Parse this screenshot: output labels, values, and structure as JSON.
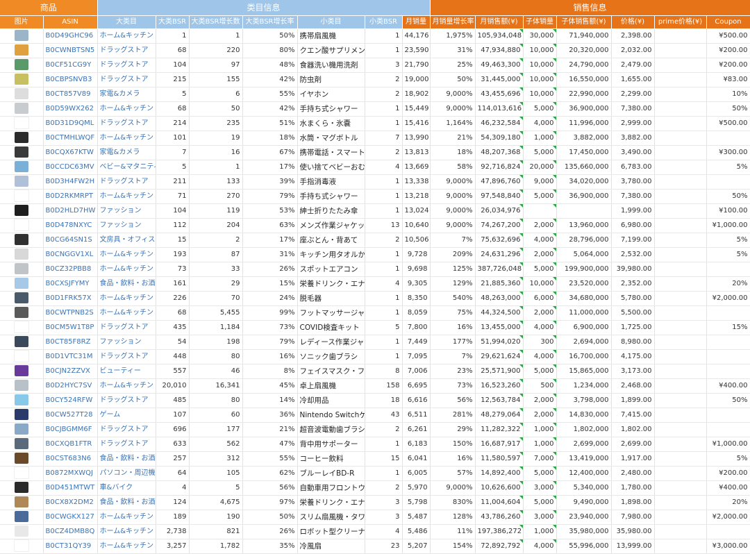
{
  "groups": [
    {
      "label": "商品",
      "span": 2,
      "cls": "h-prod"
    },
    {
      "label": "类目信息",
      "span": 7,
      "cls": "h-cat"
    },
    {
      "label": "销售信息",
      "span": 9,
      "cls": "h-sale"
    }
  ],
  "columns": [
    {
      "label": "图片",
      "cls": "h-prod"
    },
    {
      "label": "ASIN",
      "cls": "h-prod"
    },
    {
      "label": "大类目",
      "cls": "h-cat"
    },
    {
      "label": "大类BSR",
      "cls": "h-cat"
    },
    {
      "label": "大类BSR增长数",
      "cls": "h-cat"
    },
    {
      "label": "大类BSR增长率",
      "cls": "h-cat"
    },
    {
      "label": "小类目",
      "cls": "h-cat"
    },
    {
      "label": "小类BSR",
      "cls": "h-cat"
    },
    {
      "label": "月销量",
      "cls": "h-sale"
    },
    {
      "label": "月销量增长率",
      "cls": "h-sale"
    },
    {
      "label": "月销售额(¥)",
      "cls": "h-sale"
    },
    {
      "label": "子体销量",
      "cls": "h-sale"
    },
    {
      "label": "子体销售额(¥)",
      "cls": "h-sale"
    },
    {
      "label": "价格(¥)",
      "cls": "h-sale"
    },
    {
      "label": "prime价格(¥)",
      "cls": "h-sale"
    },
    {
      "label": "Coupon",
      "cls": "h-sale"
    }
  ],
  "rows": [
    {
      "thumb": "#9ab4c8",
      "asin": "B0D49GHC96",
      "cat": "ホーム&キッチン",
      "bsr": "1",
      "bsr_inc": "1",
      "bsr_rate": "50%",
      "sub": "携帯扇風機",
      "sub_bsr": "1",
      "sales": "44,176",
      "sales_rate": "1,975%",
      "revenue": "105,934,048",
      "child_sales": "30,000",
      "child_rev": "71,940,000",
      "price": "2,398.00",
      "prime": "",
      "coupon": "¥500.00"
    },
    {
      "thumb": "#e0a040",
      "asin": "B0CWNBTSN5",
      "cat": "ドラッグストア",
      "bsr": "68",
      "bsr_inc": "220",
      "bsr_rate": "80%",
      "sub": "クエン酸サプリメント",
      "sub_bsr": "1",
      "sales": "23,590",
      "sales_rate": "31%",
      "revenue": "47,934,880",
      "child_sales": "10,000",
      "child_rev": "20,320,000",
      "price": "2,032.00",
      "prime": "",
      "coupon": "¥200.00"
    },
    {
      "thumb": "#5a9a6a",
      "asin": "B0CF51CG9Y",
      "cat": "ドラッグストア",
      "bsr": "104",
      "bsr_inc": "97",
      "bsr_rate": "48%",
      "sub": "食器洗い機用洗剤",
      "sub_bsr": "3",
      "sales": "21,790",
      "sales_rate": "25%",
      "revenue": "49,463,300",
      "child_sales": "10,000",
      "child_rev": "24,790,000",
      "price": "2,479.00",
      "prime": "",
      "coupon": "¥200.00"
    },
    {
      "thumb": "#c8c060",
      "asin": "B0CBPSNVB3",
      "cat": "ドラッグストア",
      "bsr": "215",
      "bsr_inc": "155",
      "bsr_rate": "42%",
      "sub": "防虫剤",
      "sub_bsr": "2",
      "sales": "19,000",
      "sales_rate": "50%",
      "revenue": "31,445,000",
      "child_sales": "10,000",
      "child_rev": "16,550,000",
      "price": "1,655.00",
      "prime": "",
      "coupon": "¥83.00"
    },
    {
      "thumb": "#dddddd",
      "asin": "B0CT857V89",
      "cat": "家電&カメラ",
      "bsr": "5",
      "bsr_inc": "6",
      "bsr_rate": "55%",
      "sub": "イヤホン",
      "sub_bsr": "2",
      "sales": "18,902",
      "sales_rate": "9,000%",
      "revenue": "43,455,696",
      "child_sales": "10,000",
      "child_rev": "22,990,000",
      "price": "2,299.00",
      "prime": "",
      "coupon": "10%"
    },
    {
      "thumb": "#c8ccd0",
      "asin": "B0D59WX262",
      "cat": "ホーム&キッチン",
      "bsr": "68",
      "bsr_inc": "50",
      "bsr_rate": "42%",
      "sub": "手持ち式シャワー",
      "sub_bsr": "1",
      "sales": "15,449",
      "sales_rate": "9,000%",
      "revenue": "114,013,616",
      "child_sales": "5,000",
      "child_rev": "36,900,000",
      "price": "7,380.00",
      "prime": "",
      "coupon": "50%"
    },
    {
      "thumb": "#ffffff",
      "asin": "B0D31D9QML",
      "cat": "ドラッグストア",
      "bsr": "214",
      "bsr_inc": "235",
      "bsr_rate": "51%",
      "sub": "水まくら・氷嚢",
      "sub_bsr": "1",
      "sales": "15,416",
      "sales_rate": "1,164%",
      "revenue": "46,232,584",
      "child_sales": "4,000",
      "child_rev": "11,996,000",
      "price": "2,999.00",
      "prime": "",
      "coupon": "¥500.00"
    },
    {
      "thumb": "#2a2a2a",
      "asin": "B0CTMHLWQF",
      "cat": "ホーム&キッチン",
      "bsr": "101",
      "bsr_inc": "19",
      "bsr_rate": "18%",
      "sub": "水筒・マグボトル",
      "sub_bsr": "7",
      "sales": "13,990",
      "sales_rate": "21%",
      "revenue": "54,309,180",
      "child_sales": "1,000",
      "child_rev": "3,882,000",
      "price": "3,882.00",
      "prime": "",
      "coupon": ""
    },
    {
      "thumb": "#3a3a3a",
      "asin": "B0CQX67KTW",
      "cat": "家電&カメラ",
      "bsr": "7",
      "bsr_inc": "16",
      "bsr_rate": "67%",
      "sub": "携帯電話・スマートフォン用モバイルバッテリー",
      "sub_bsr": "2",
      "sales": "13,813",
      "sales_rate": "18%",
      "revenue": "48,207,368",
      "child_sales": "5,000",
      "child_rev": "17,450,000",
      "price": "3,490.00",
      "prime": "",
      "coupon": "¥300.00"
    },
    {
      "thumb": "#7ab0d8",
      "asin": "B0CCDC63MV",
      "cat": "ベビー&マタニティ",
      "bsr": "5",
      "bsr_inc": "1",
      "bsr_rate": "17%",
      "sub": "使い捨てベビーおむつ",
      "sub_bsr": "4",
      "sales": "13,669",
      "sales_rate": "58%",
      "revenue": "92,716,824",
      "child_sales": "20,000",
      "child_rev": "135,660,000",
      "price": "6,783.00",
      "prime": "",
      "coupon": "5%"
    },
    {
      "thumb": "#b0c0d8",
      "asin": "B0D3H4FW2H",
      "cat": "ドラッグストア",
      "bsr": "211",
      "bsr_inc": "133",
      "bsr_rate": "39%",
      "sub": "手指消毒液",
      "sub_bsr": "1",
      "sales": "13,338",
      "sales_rate": "9,000%",
      "revenue": "47,896,760",
      "child_sales": "9,000",
      "child_rev": "34,020,000",
      "price": "3,780.00",
      "prime": "",
      "coupon": ""
    },
    {
      "thumb": "#ffffff",
      "asin": "B0D2RKMRPT",
      "cat": "ホーム&キッチン",
      "bsr": "71",
      "bsr_inc": "270",
      "bsr_rate": "79%",
      "sub": "手持ち式シャワー",
      "sub_bsr": "1",
      "sales": "13,218",
      "sales_rate": "9,000%",
      "revenue": "97,548,840",
      "child_sales": "5,000",
      "child_rev": "36,900,000",
      "price": "7,380.00",
      "prime": "",
      "coupon": "50%"
    },
    {
      "thumb": "#1e1e1e",
      "asin": "B0D2HLD7HW",
      "cat": "ファッション",
      "bsr": "104",
      "bsr_inc": "119",
      "bsr_rate": "53%",
      "sub": "紳士折りたたみ傘",
      "sub_bsr": "1",
      "sales": "13,024",
      "sales_rate": "9,000%",
      "revenue": "26,034,976",
      "child_sales": "",
      "child_rev": "",
      "price": "1,999.00",
      "prime": "",
      "coupon": "¥100.00"
    },
    {
      "thumb": "#ffffff",
      "asin": "B0D478NXYC",
      "cat": "ファッション",
      "bsr": "112",
      "bsr_inc": "204",
      "bsr_rate": "63%",
      "sub": "メンズ作業ジャケット・コート",
      "sub_bsr": "13",
      "sales": "10,640",
      "sales_rate": "9,000%",
      "revenue": "74,267,200",
      "child_sales": "2,000",
      "child_rev": "13,960,000",
      "price": "6,980.00",
      "prime": "",
      "coupon": "¥1,000.00"
    },
    {
      "thumb": "#303030",
      "asin": "B0CG64SN1S",
      "cat": "文房具・オフィス",
      "bsr": "15",
      "bsr_inc": "2",
      "bsr_rate": "17%",
      "sub": "座ぶとん・背あて",
      "sub_bsr": "2",
      "sales": "10,506",
      "sales_rate": "7%",
      "revenue": "75,632,696",
      "child_sales": "4,000",
      "child_rev": "28,796,000",
      "price": "7,199.00",
      "prime": "",
      "coupon": "5%"
    },
    {
      "thumb": "#d8d8d8",
      "asin": "B0CNGGV1XL",
      "cat": "ホーム&キッチン",
      "bsr": "193",
      "bsr_inc": "87",
      "bsr_rate": "31%",
      "sub": "キッチン用タオルかけ・フック",
      "sub_bsr": "1",
      "sales": "9,728",
      "sales_rate": "209%",
      "revenue": "24,631,296",
      "child_sales": "2,000",
      "child_rev": "5,064,000",
      "price": "2,532.00",
      "prime": "",
      "coupon": "5%"
    },
    {
      "thumb": "#c0c4c8",
      "asin": "B0CZ32PBB8",
      "cat": "ホーム&キッチン",
      "bsr": "73",
      "bsr_inc": "33",
      "bsr_rate": "26%",
      "sub": "スポットエアコン",
      "sub_bsr": "1",
      "sales": "9,698",
      "sales_rate": "125%",
      "revenue": "387,726,048",
      "child_sales": "5,000",
      "child_rev": "199,900,000",
      "price": "39,980.00",
      "prime": "",
      "coupon": ""
    },
    {
      "thumb": "#a8c8e8",
      "asin": "B0CXSJFYMY",
      "cat": "食品・飲料・お酒",
      "bsr": "161",
      "bsr_inc": "29",
      "bsr_rate": "15%",
      "sub": "栄養ドリンク・エナジードリンク",
      "sub_bsr": "4",
      "sales": "9,305",
      "sales_rate": "129%",
      "revenue": "21,885,360",
      "child_sales": "10,000",
      "child_rev": "23,520,000",
      "price": "2,352.00",
      "prime": "",
      "coupon": "20%"
    },
    {
      "thumb": "#4a5a6a",
      "asin": "B0D1FRK57X",
      "cat": "ホーム&キッチン",
      "bsr": "226",
      "bsr_inc": "70",
      "bsr_rate": "24%",
      "sub": "脱毛器",
      "sub_bsr": "1",
      "sales": "8,350",
      "sales_rate": "540%",
      "revenue": "48,263,000",
      "child_sales": "6,000",
      "child_rev": "34,680,000",
      "price": "5,780.00",
      "prime": "",
      "coupon": "¥2,000.00"
    },
    {
      "thumb": "#5a5a5a",
      "asin": "B0CWTPNB2S",
      "cat": "ホーム&キッチン",
      "bsr": "68",
      "bsr_inc": "5,455",
      "bsr_rate": "99%",
      "sub": "フットマッサージャー",
      "sub_bsr": "1",
      "sales": "8,059",
      "sales_rate": "75%",
      "revenue": "44,324,500",
      "child_sales": "2,000",
      "child_rev": "11,000,000",
      "price": "5,500.00",
      "prime": "",
      "coupon": ""
    },
    {
      "thumb": "#ffffff",
      "asin": "B0CM5W1T8P",
      "cat": "ドラッグストア",
      "bsr": "435",
      "bsr_inc": "1,184",
      "bsr_rate": "73%",
      "sub": "COVID検査キット",
      "sub_bsr": "5",
      "sales": "7,800",
      "sales_rate": "16%",
      "revenue": "13,455,000",
      "child_sales": "4,000",
      "child_rev": "6,900,000",
      "price": "1,725.00",
      "prime": "",
      "coupon": "15%"
    },
    {
      "thumb": "#3a4a5a",
      "asin": "B0CT85F8RZ",
      "cat": "ファッション",
      "bsr": "54",
      "bsr_inc": "198",
      "bsr_rate": "79%",
      "sub": "レディース作業ジャケット・コート",
      "sub_bsr": "1",
      "sales": "7,449",
      "sales_rate": "177%",
      "revenue": "51,994,020",
      "child_sales": "300",
      "child_rev": "2,694,000",
      "price": "8,980.00",
      "prime": "",
      "coupon": ""
    },
    {
      "thumb": "#ffffff",
      "asin": "B0D1VTC31M",
      "cat": "ドラッグストア",
      "bsr": "448",
      "bsr_inc": "80",
      "bsr_rate": "16%",
      "sub": "ソニック歯ブラシ",
      "sub_bsr": "1",
      "sales": "7,095",
      "sales_rate": "7%",
      "revenue": "29,621,624",
      "child_sales": "4,000",
      "child_rev": "16,700,000",
      "price": "4,175.00",
      "prime": "",
      "coupon": ""
    },
    {
      "thumb": "#6a3a9a",
      "asin": "B0CJN2ZZVX",
      "cat": "ビューティー",
      "bsr": "557",
      "bsr_inc": "46",
      "bsr_rate": "8%",
      "sub": "フェイスマスク・フェイスパック",
      "sub_bsr": "8",
      "sales": "7,006",
      "sales_rate": "23%",
      "revenue": "25,571,900",
      "child_sales": "5,000",
      "child_rev": "15,865,000",
      "price": "3,173.00",
      "prime": "",
      "coupon": ""
    },
    {
      "thumb": "#b8c0c8",
      "asin": "B0D2HYC7SV",
      "cat": "ホーム&キッチン",
      "bsr": "20,010",
      "bsr_inc": "16,341",
      "bsr_rate": "45%",
      "sub": "卓上扇風機",
      "sub_bsr": "158",
      "sales": "6,695",
      "sales_rate": "73%",
      "revenue": "16,523,260",
      "child_sales": "500",
      "child_rev": "1,234,000",
      "price": "2,468.00",
      "prime": "",
      "coupon": "¥400.00"
    },
    {
      "thumb": "#88c8e8",
      "asin": "B0CY524RFW",
      "cat": "ドラッグストア",
      "bsr": "485",
      "bsr_inc": "80",
      "bsr_rate": "14%",
      "sub": "冷却用品",
      "sub_bsr": "18",
      "sales": "6,616",
      "sales_rate": "56%",
      "revenue": "12,563,784",
      "child_sales": "2,000",
      "child_rev": "3,798,000",
      "price": "1,899.00",
      "prime": "",
      "coupon": "50%"
    },
    {
      "thumb": "#2a3a6a",
      "asin": "B0CW527T28",
      "cat": "ゲーム",
      "bsr": "107",
      "bsr_inc": "60",
      "bsr_rate": "36%",
      "sub": "Nintendo Switchゲームソフト",
      "sub_bsr": "43",
      "sales": "6,511",
      "sales_rate": "281%",
      "revenue": "48,279,064",
      "child_sales": "2,000",
      "child_rev": "14,830,000",
      "price": "7,415.00",
      "prime": "",
      "coupon": ""
    },
    {
      "thumb": "#8aa8c8",
      "asin": "B0CJBGMM6F",
      "cat": "ドラッグストア",
      "bsr": "696",
      "bsr_inc": "177",
      "bsr_rate": "21%",
      "sub": "超音波電動歯ブラシ",
      "sub_bsr": "2",
      "sales": "6,261",
      "sales_rate": "29%",
      "revenue": "11,282,322",
      "child_sales": "1,000",
      "child_rev": "1,802,000",
      "price": "1,802.00",
      "prime": "",
      "coupon": ""
    },
    {
      "thumb": "#5a6a7a",
      "asin": "B0CXQB1FTR",
      "cat": "ドラッグストア",
      "bsr": "633",
      "bsr_inc": "562",
      "bsr_rate": "47%",
      "sub": "背中用サポーター",
      "sub_bsr": "1",
      "sales": "6,183",
      "sales_rate": "150%",
      "revenue": "16,687,917",
      "child_sales": "1,000",
      "child_rev": "2,699,000",
      "price": "2,699.00",
      "prime": "",
      "coupon": "¥1,000.00"
    },
    {
      "thumb": "#6a4a2a",
      "asin": "B0CST683N6",
      "cat": "食品・飲料・お酒",
      "bsr": "257",
      "bsr_inc": "312",
      "bsr_rate": "55%",
      "sub": "コーヒー飲料",
      "sub_bsr": "15",
      "sales": "6,041",
      "sales_rate": "16%",
      "revenue": "11,580,597",
      "child_sales": "7,000",
      "child_rev": "13,419,000",
      "price": "1,917.00",
      "prime": "",
      "coupon": "5%"
    },
    {
      "thumb": "#ffffff",
      "asin": "B0872MXWQJ",
      "cat": "パソコン・周辺機",
      "bsr": "64",
      "bsr_inc": "105",
      "bsr_rate": "62%",
      "sub": "ブルーレイBD-R",
      "sub_bsr": "1",
      "sales": "6,005",
      "sales_rate": "57%",
      "revenue": "14,892,400",
      "child_sales": "5,000",
      "child_rev": "12,400,000",
      "price": "2,480.00",
      "prime": "",
      "coupon": "¥200.00"
    },
    {
      "thumb": "#2a2a2a",
      "asin": "B0D451MTWT",
      "cat": "車&バイク",
      "bsr": "4",
      "bsr_inc": "5",
      "bsr_rate": "56%",
      "sub": "自動車用フロントウィンドウ用サンシェード",
      "sub_bsr": "2",
      "sales": "5,970",
      "sales_rate": "9,000%",
      "revenue": "10,626,600",
      "child_sales": "3,000",
      "child_rev": "5,340,000",
      "price": "1,780.00",
      "prime": "",
      "coupon": "¥400.00"
    },
    {
      "thumb": "#b08858",
      "asin": "B0CX8X2DM2",
      "cat": "食品・飲料・お酒",
      "bsr": "124",
      "bsr_inc": "4,675",
      "bsr_rate": "97%",
      "sub": "栄養ドリンク・エナジードリンク",
      "sub_bsr": "3",
      "sales": "5,798",
      "sales_rate": "830%",
      "revenue": "11,004,604",
      "child_sales": "5,000",
      "child_rev": "9,490,000",
      "price": "1,898.00",
      "prime": "",
      "coupon": "20%"
    },
    {
      "thumb": "#4a6a9a",
      "asin": "B0CWGKX127",
      "cat": "ホーム&キッチン",
      "bsr": "189",
      "bsr_inc": "190",
      "bsr_rate": "50%",
      "sub": "スリム扇風機・タワーファン",
      "sub_bsr": "3",
      "sales": "5,487",
      "sales_rate": "128%",
      "revenue": "43,786,260",
      "child_sales": "3,000",
      "child_rev": "23,940,000",
      "price": "7,980.00",
      "prime": "",
      "coupon": "¥2,000.00"
    },
    {
      "thumb": "#e8e8e8",
      "asin": "B0CZ4DMB8Q",
      "cat": "ホーム&キッチン",
      "bsr": "2,738",
      "bsr_inc": "821",
      "bsr_rate": "26%",
      "sub": "ロボット型クリーナー",
      "sub_bsr": "4",
      "sales": "5,486",
      "sales_rate": "11%",
      "revenue": "197,386,272",
      "child_sales": "1,000",
      "child_rev": "35,980,000",
      "price": "35,980.00",
      "prime": "",
      "coupon": ""
    },
    {
      "thumb": "#ffffff",
      "asin": "B0CT31QY39",
      "cat": "ホーム&キッチン",
      "bsr": "3,257",
      "bsr_inc": "1,782",
      "bsr_rate": "35%",
      "sub": "冷風扇",
      "sub_bsr": "23",
      "sales": "5,207",
      "sales_rate": "154%",
      "revenue": "72,892,792",
      "child_sales": "4,000",
      "child_rev": "55,996,000",
      "price": "13,999.00",
      "prime": "",
      "coupon": "¥3,000.00"
    }
  ]
}
